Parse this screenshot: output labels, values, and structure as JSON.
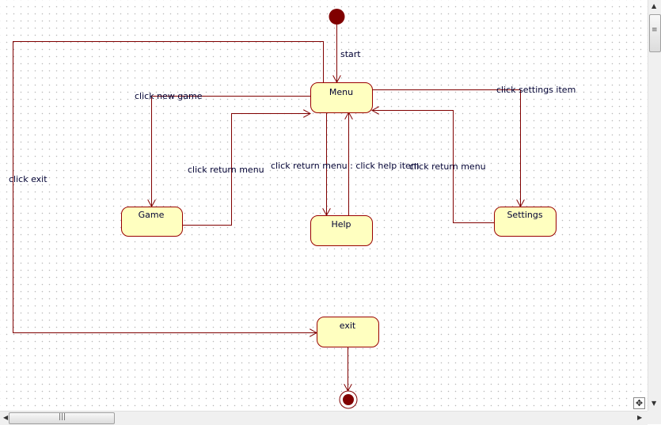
{
  "diagram": {
    "states": {
      "menu": "Menu",
      "game": "Game",
      "help": "Help",
      "settings": "Settings",
      "exit": "exit"
    },
    "transitions": {
      "start": "start",
      "new_game": "click new game",
      "game_return": "click return menu",
      "help": "click return menu : click help item",
      "settings": "click settings item",
      "settings_return": "click return menu",
      "exit": "click exit"
    }
  },
  "colors": {
    "line": "#800000",
    "state_fill": "#ffffc0",
    "state_border": "#990000",
    "node": "#800000"
  },
  "icons": {
    "scroll_up": "triangle-up",
    "scroll_down": "triangle-down",
    "scroll_left": "triangle-left",
    "scroll_right": "triangle-right",
    "corner": "move-icon"
  }
}
